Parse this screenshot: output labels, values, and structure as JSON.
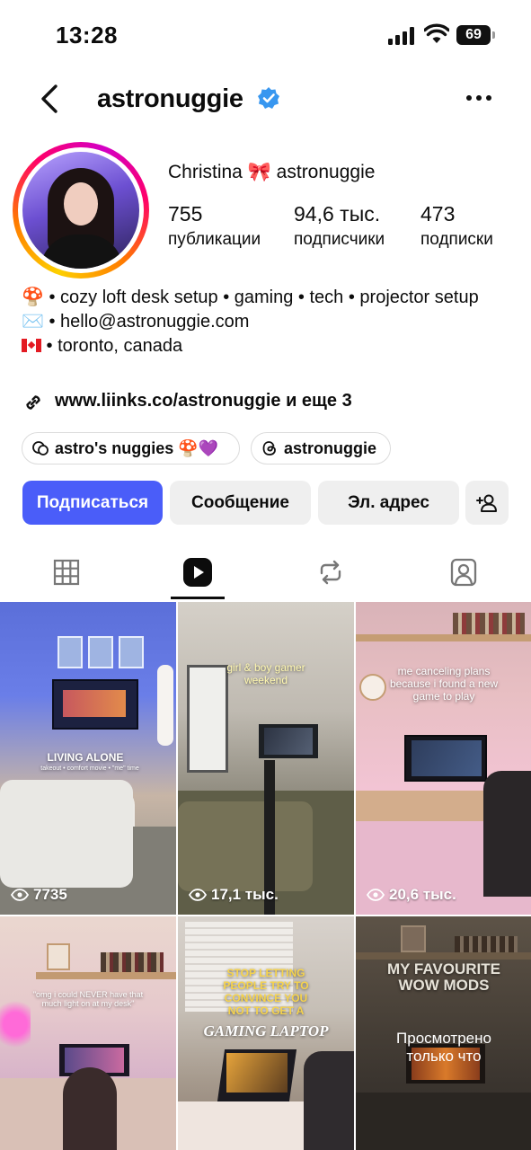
{
  "status": {
    "time": "13:28",
    "battery": "69"
  },
  "header": {
    "username": "astronuggie"
  },
  "profile": {
    "display_name": "Christina 🎀 astronuggie",
    "stats": [
      {
        "value": "755",
        "label": "публикации"
      },
      {
        "value": "94,6 тыс.",
        "label": "подписчики"
      },
      {
        "value": "473",
        "label": "подписки"
      }
    ],
    "bio": {
      "line1": "🍄 • cozy loft desk setup • gaming • tech • projector setup",
      "line2": "✉️ • hello@astronuggie.com",
      "line3": " • toronto, canada"
    },
    "link": "www.liinks.co/astronuggie и еще 3",
    "chips": [
      {
        "label": "astro's nuggies 🍄💜"
      },
      {
        "label": "astronuggie"
      }
    ]
  },
  "buttons": {
    "follow": "Подписаться",
    "message": "Сообщение",
    "email": "Эл. адрес",
    "icons": [
      "add-person-icon"
    ]
  },
  "tabs": {
    "active": "reels",
    "icons": [
      "grid-icon",
      "reels-icon",
      "reposts-icon",
      "tagged-icon"
    ]
  },
  "grid": [
    {
      "caption": "LIVING ALONE",
      "subcaption": "takeout • comfort movie • \"me\" time",
      "views": "7735"
    },
    {
      "caption": "girl & boy gamer weekend",
      "views": "17,1 тыс."
    },
    {
      "caption": "me canceling plans because i found a new game to play",
      "views": "20,6 тыс."
    },
    {
      "caption": "\"omg i could NEVER have that much light on at my desk\"",
      "views": ""
    },
    {
      "caption": "STOP LETTING PEOPLE TRY TO CONVINCE YOU NOT TO GET A",
      "subcaption": "GAMING LAPTOP",
      "views": ""
    },
    {
      "caption": "MY FAVOURITE WOW MODS",
      "subcaption": "Просмотрено только что",
      "views": ""
    }
  ]
}
